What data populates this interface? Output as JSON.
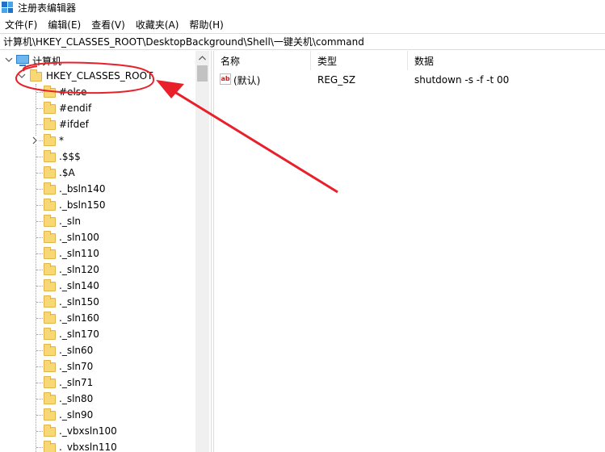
{
  "window": {
    "title": "注册表编辑器",
    "icon": "registry-editor-icon"
  },
  "menu": [
    {
      "label": "文件(F)"
    },
    {
      "label": "编辑(E)"
    },
    {
      "label": "查看(V)"
    },
    {
      "label": "收藏夹(A)"
    },
    {
      "label": "帮助(H)"
    }
  ],
  "address": {
    "path": "计算机\\HKEY_CLASSES_ROOT\\DesktopBackground\\Shell\\一键关机\\command"
  },
  "tree": {
    "root_label": "计算机",
    "hive_label": "HKEY_CLASSES_ROOT",
    "keys": [
      {
        "label": "#else",
        "expandable": false
      },
      {
        "label": "#endif",
        "expandable": false
      },
      {
        "label": "#ifdef",
        "expandable": false
      },
      {
        "label": "*",
        "expandable": true
      },
      {
        "label": ".$$$",
        "expandable": false
      },
      {
        "label": ".$A",
        "expandable": false
      },
      {
        "label": "._bsln140",
        "expandable": false
      },
      {
        "label": "._bsln150",
        "expandable": false
      },
      {
        "label": "._sln",
        "expandable": false
      },
      {
        "label": "._sln100",
        "expandable": false
      },
      {
        "label": "._sln110",
        "expandable": false
      },
      {
        "label": "._sln120",
        "expandable": false
      },
      {
        "label": "._sln140",
        "expandable": false
      },
      {
        "label": "._sln150",
        "expandable": false
      },
      {
        "label": "._sln160",
        "expandable": false
      },
      {
        "label": "._sln170",
        "expandable": false
      },
      {
        "label": "._sln60",
        "expandable": false
      },
      {
        "label": "._sln70",
        "expandable": false
      },
      {
        "label": "._sln71",
        "expandable": false
      },
      {
        "label": "._sln80",
        "expandable": false
      },
      {
        "label": "._sln90",
        "expandable": false
      },
      {
        "label": "._vbxsln100",
        "expandable": false
      },
      {
        "label": "._vbxsln110",
        "expandable": false
      }
    ]
  },
  "list": {
    "columns": [
      "名称",
      "类型",
      "数据"
    ],
    "rows": [
      {
        "name": "(默认)",
        "type": "REG_SZ",
        "data": "shutdown -s -f -t 00",
        "icon": "string-value-icon",
        "icon_text": "ab"
      }
    ]
  },
  "colors": {
    "annotation": "#e8202a",
    "folder": "#f8d775"
  }
}
